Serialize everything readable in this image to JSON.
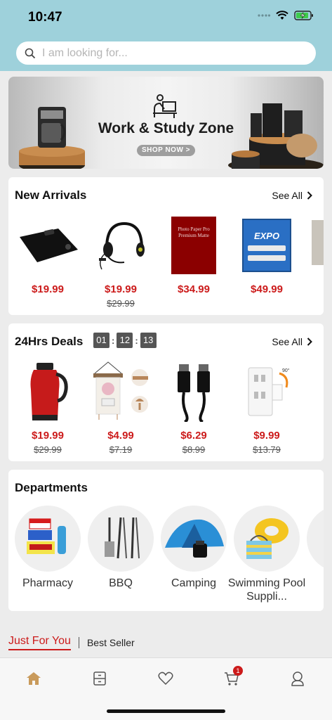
{
  "status": {
    "time": "10:47"
  },
  "search": {
    "placeholder": "I am looking for..."
  },
  "banner": {
    "title": "Work & Study Zone",
    "button": "SHOP NOW >"
  },
  "new_arrivals": {
    "title": "New Arrivals",
    "see_all": "See All",
    "products": [
      {
        "price": "$19.99",
        "old_price": "",
        "image": "clipboard-case"
      },
      {
        "price": "$19.99",
        "old_price": "$29.99",
        "image": "headset"
      },
      {
        "price": "$34.99",
        "old_price": "",
        "image": "photo-paper",
        "image_text": "Photo Paper Pro Premium Matte"
      },
      {
        "price": "$49.99",
        "old_price": "",
        "image": "expo-markers",
        "image_text": "EXPO"
      }
    ]
  },
  "deals": {
    "title": "24Hrs Deals",
    "timer": {
      "hours": "01",
      "minutes": "12",
      "seconds": "13"
    },
    "see_all": "See All",
    "products": [
      {
        "price": "$19.99",
        "old_price": "$29.99",
        "image": "thermal-carafe"
      },
      {
        "price": "$4.99",
        "old_price": "$7.19",
        "image": "wall-hanging"
      },
      {
        "price": "$6.29",
        "old_price": "$8.99",
        "image": "displayport-cable"
      },
      {
        "price": "$9.99",
        "old_price": "$13.79",
        "image": "outlet-shelf"
      }
    ]
  },
  "departments": {
    "title": "Departments",
    "items": [
      {
        "label": "Pharmacy",
        "image": "pharmacy-products"
      },
      {
        "label": "BBQ",
        "image": "bbq-tools"
      },
      {
        "label": "Camping",
        "image": "tent"
      },
      {
        "label": "Swimming Pool Suppli...",
        "image": "pool-float"
      }
    ]
  },
  "tabs": {
    "active": "Just For You",
    "inactive": "Best Seller"
  },
  "bottom_nav": {
    "cart_count": "1"
  },
  "colors": {
    "accent": "#cc1b1b",
    "header": "#9ed1db",
    "home_active": "#c99a5b"
  }
}
